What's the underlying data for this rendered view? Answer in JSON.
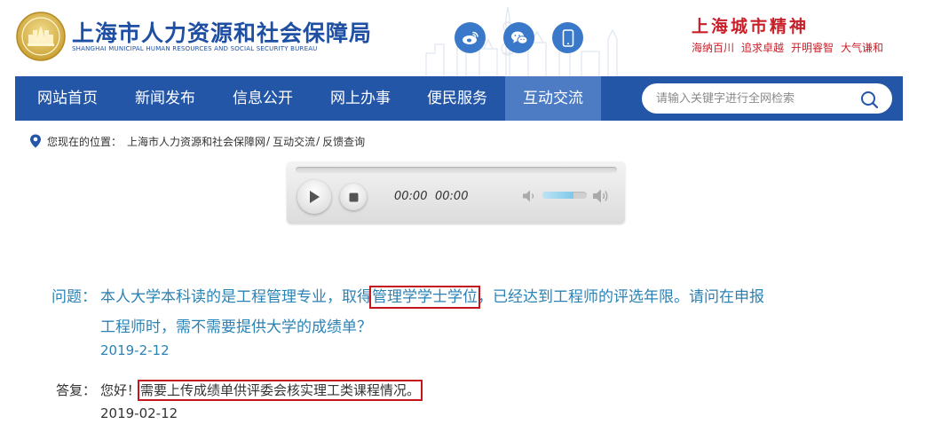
{
  "header": {
    "title": "上海市人力资源和社会保障局",
    "subtitle": "SHANGHAI MUNICIPAL HUMAN RESOURCES AND SOCIAL SECURITY BUREAU",
    "social_icons": [
      "weibo-icon",
      "wechat-icon",
      "mobile-icon"
    ],
    "city_spirit": {
      "title": "上海城市精神",
      "items": [
        "海纳百川",
        "追求卓越",
        "开明睿智",
        "大气谦和"
      ]
    }
  },
  "nav": {
    "items": [
      "网站首页",
      "新闻发布",
      "信息公开",
      "网上办事",
      "便民服务",
      "互动交流"
    ],
    "active_index": 5,
    "search_placeholder": "请输入关键字进行全网检索"
  },
  "breadcrumb": {
    "label": "您现在的位置：",
    "crumbs": [
      "上海市人力资源和社会保障网",
      "互动交流",
      "反馈查询"
    ],
    "separator": "/"
  },
  "player": {
    "current_time": "00:00",
    "duration": "00:00",
    "volume_level": 0.7
  },
  "qa": {
    "question_label": "问题：",
    "question_before": "本人大学本科读的是工程管理专业，取得",
    "question_highlight": "管理学学士学位",
    "question_after": "，已经达到工程师的评选年限。请问在申报",
    "question_line2": "工程师时，需不需要提供大学的成绩单？",
    "question_date": "2019-2-12",
    "answer_label": "答复：",
    "answer_prefix": "您好！",
    "answer_highlight": "需要上传成绩单供评委会核实理工类课程情况。",
    "answer_date": "2019-02-12"
  },
  "colors": {
    "brand_blue": "#2456a8",
    "nav_active": "#4d7cc4",
    "accent_red": "#c8202a",
    "question_text": "#2b82b5",
    "highlight_border": "#c4161c"
  }
}
